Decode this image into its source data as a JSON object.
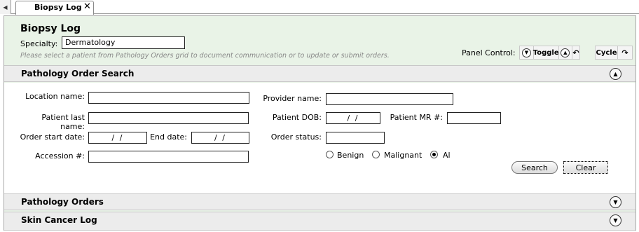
{
  "tabstrip": {
    "nav_icon": "caret-left-icon",
    "tab_label": "Biopsy Log",
    "close_icon": "close-icon"
  },
  "header": {
    "title": "Biopsy Log",
    "specialty_label": "Specialty:",
    "specialty_value": "Dermatology",
    "hint": "Please select a patient from Pathology Orders grid to document communication or to update or submit orders.",
    "panel_control_label": "Panel Control:",
    "toggle_label": "Toggle",
    "cycle_label": "Cycle"
  },
  "sections": {
    "search": "Pathology Order Search",
    "orders": "Pathology Orders",
    "skin_cancer": "Skin Cancer Log"
  },
  "form": {
    "location_label": "Location name:",
    "provider_label": "Provider name:",
    "patient_last_label": "Patient last name:",
    "dob_label": "Patient DOB:",
    "dob_value": "/ /",
    "mr_label": "Patient MR #:",
    "order_start_label": "Order start date:",
    "order_start_value": "/ /",
    "end_label": "End date:",
    "end_value": "/ /",
    "status_label": "Order status:",
    "accession_label": "Accession #:",
    "radio_benign": "Benign",
    "radio_malignant": "Malignant",
    "radio_all": "Al",
    "search_button": "Search",
    "clear_button": "Clear"
  },
  "colors": {
    "frame_bg": "#e9f3e7",
    "section_bg": "#ececec",
    "hint_text": "#888888"
  }
}
